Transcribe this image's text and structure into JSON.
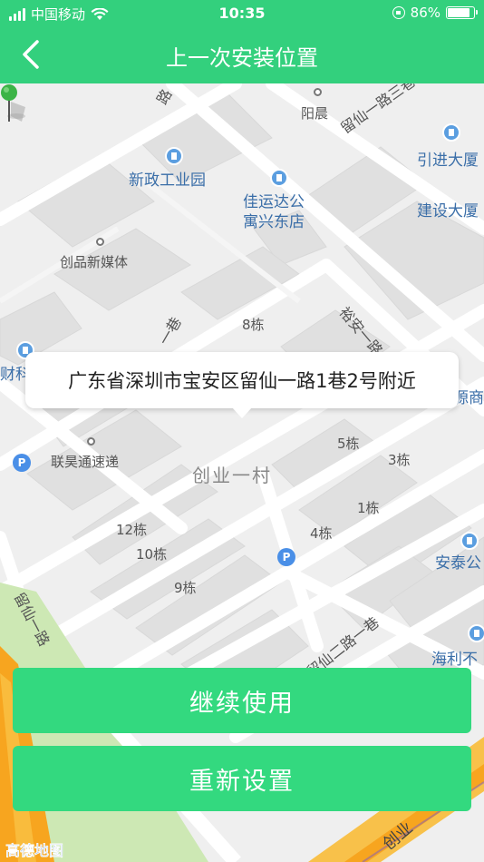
{
  "status_bar": {
    "carrier": "中国移动",
    "time": "10:35",
    "battery": "86%",
    "battery_level": 0.86
  },
  "nav": {
    "title": "上一次安装位置",
    "back_icon": "chevron-left-icon"
  },
  "map": {
    "address_popup": "广东省深圳市宝安区留仙一路1巷2号附近",
    "labels": {
      "road_top_left": "路",
      "yangchen": "阳晨",
      "road_liuxian_3": "留仙一路三巷",
      "yinjin": "引进大厦",
      "xinzheng": "新政工业园",
      "jiayunda_1": "佳运达公",
      "jiayunda_2": "寓兴东店",
      "jianshe": "建设大厦",
      "chuangpin": "创品新媒体",
      "yuan_road": "裕安一路",
      "building8": "8栋",
      "lane1_left": "一巷",
      "caishang": "财科",
      "yuanshang": "源商",
      "lianhao": "联昊通速递",
      "building5": "5栋",
      "building3": "3栋",
      "chuangye": "创业一村",
      "building1": "1栋",
      "building12": "12栋",
      "building4": "4栋",
      "building10": "10栋",
      "antai": "安泰公",
      "building9": "9栋",
      "liuxian2": "留仙二路一巷",
      "liuxian_left": "留仙一路",
      "haili": "海利不",
      "chuang_bottom": "创业"
    }
  },
  "buttons": {
    "continue": "继续使用",
    "reset": "重新设置"
  },
  "logo": "高德地图",
  "colors": {
    "brand_green": "#33d07d",
    "button_green": "#33d97f",
    "pin_green": "#3cb447"
  }
}
